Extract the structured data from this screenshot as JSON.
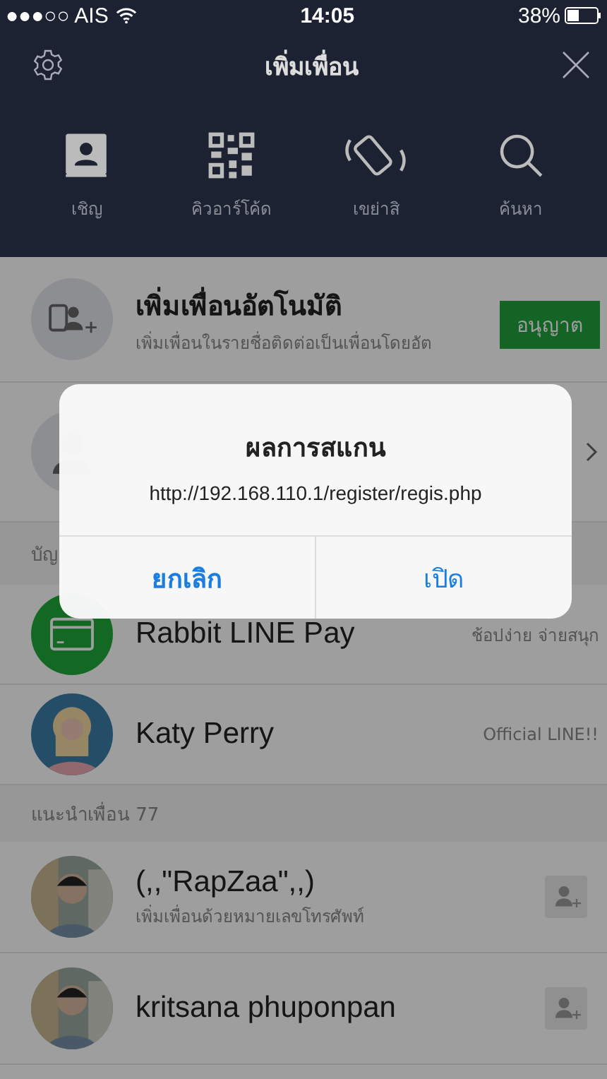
{
  "status_bar": {
    "carrier": "●●●○○ AIS",
    "time": "14:05",
    "battery": "38%"
  },
  "header": {
    "title": "เพิ่มเพื่อน"
  },
  "actions": [
    {
      "kind": "invite",
      "label": "เชิญ"
    },
    {
      "kind": "qr",
      "label": "คิวอาร์โค้ด"
    },
    {
      "kind": "shake",
      "label": "เขย่าสิ"
    },
    {
      "kind": "search",
      "label": "ค้นหา"
    }
  ],
  "auto_add": {
    "title": "เพิ่มเพื่อนอัตโนมัติ",
    "subtitle": "เพิ่มเพื่อนในรายชื่อติดต่อเป็นเพื่อนโดยอัต",
    "button": "อนุญาต"
  },
  "section_1": {
    "title": "บัญ"
  },
  "official_accounts": [
    {
      "name": "Rabbit LINE Pay",
      "note": "ช้อปง่าย จ่ายสนุก",
      "kind": "card"
    },
    {
      "name": "Katy Perry",
      "note": "Official LINE!!",
      "kind": "picture"
    }
  ],
  "section_2": {
    "title": "แนะนำเพื่อน 77"
  },
  "suggestions": [
    {
      "name": "(,,\"RapZaa\",,)",
      "subtitle": "เพิ่มเพื่อนด้วยหมายเลขโทรศัพท์"
    },
    {
      "name": "kritsana phuponpan"
    }
  ],
  "dialog": {
    "title": "ผลการสแกน",
    "message": "http://192.168.110.1/register/regis.php",
    "buttons": [
      "ยกเลิก",
      "เปิด"
    ]
  }
}
